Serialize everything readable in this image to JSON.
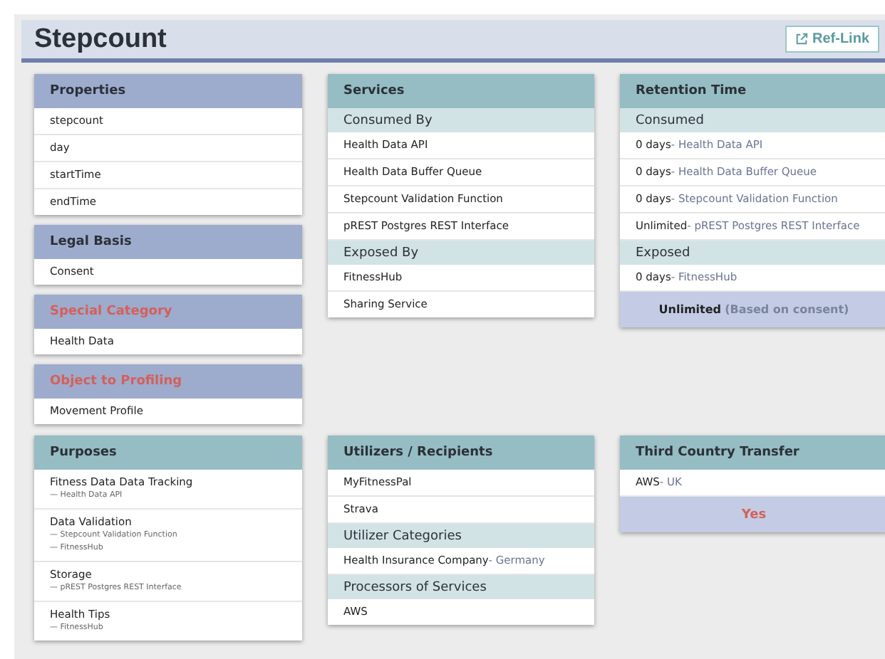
{
  "page": {
    "title": "Stepcount",
    "ref_link": "Ref-Link"
  },
  "rows": [
    [
      [
        {
          "title": "Properties",
          "color": "#9dabcd",
          "alert": false,
          "sections": [
            {
              "items": [
                {
                  "text": "stepcount"
                },
                {
                  "text": "day"
                },
                {
                  "text": "startTime"
                },
                {
                  "text": "endTime"
                }
              ]
            }
          ]
        },
        {
          "title": "Legal Basis",
          "color": "#9dabcd",
          "alert": false,
          "sections": [
            {
              "items": [
                {
                  "text": "Consent"
                }
              ]
            }
          ]
        },
        {
          "title": "Special Category",
          "color": "#9dabcd",
          "alert": true,
          "sections": [
            {
              "items": [
                {
                  "text": "Health Data"
                }
              ]
            }
          ]
        },
        {
          "title": "Object to Profiling",
          "color": "#9dabcd",
          "alert": true,
          "sections": [
            {
              "items": [
                {
                  "text": "Movement Profile"
                }
              ]
            }
          ]
        }
      ],
      [
        {
          "title": "Services",
          "color": "#95bdc3",
          "alert": false,
          "sections": [
            {
              "heading": "Consumed By",
              "items": [
                {
                  "text": "Health Data API"
                },
                {
                  "text": "Health Data Buffer Queue"
                },
                {
                  "text": "Stepcount Validation Function"
                },
                {
                  "text": "pREST Postgres REST Interface"
                }
              ]
            },
            {
              "heading": "Exposed By",
              "items": [
                {
                  "text": "FitnessHub"
                },
                {
                  "text": "Sharing Service"
                }
              ]
            }
          ]
        }
      ],
      [
        {
          "title": "Retention Time",
          "color": "#95bdc3",
          "alert": false,
          "sections": [
            {
              "heading": "Consumed",
              "items": [
                {
                  "text": "0 days",
                  "note": "- Health Data API"
                },
                {
                  "text": "0 days",
                  "note": "- Health Data Buffer Queue"
                },
                {
                  "text": "0 days",
                  "note": "- Stepcount Validation Function"
                },
                {
                  "text": "Unlimited",
                  "note": "- pREST Postgres REST Interface"
                }
              ]
            },
            {
              "heading": "Exposed",
              "items": [
                {
                  "text": "0 days",
                  "note": "- FitnessHub"
                }
              ]
            }
          ],
          "footer": {
            "kind": "summary",
            "value": "Unlimited",
            "note": "(Based on consent)"
          }
        }
      ]
    ],
    [
      [
        {
          "title": "Purposes",
          "color": "#95bdc3",
          "alert": false,
          "sections": [
            {
              "items": [
                {
                  "text": "Fitness Data Data Tracking",
                  "sub": [
                    "— Health Data API"
                  ]
                },
                {
                  "text": "Data Validation",
                  "sub": [
                    "— Stepcount Validation Function",
                    "— FitnessHub"
                  ]
                },
                {
                  "text": "Storage",
                  "sub": [
                    "— pREST Postgres REST Interface"
                  ]
                },
                {
                  "text": "Health Tips",
                  "sub": [
                    "— FitnessHub"
                  ]
                }
              ]
            }
          ]
        }
      ],
      [
        {
          "title": "Utilizers / Recipients",
          "color": "#95bdc3",
          "alert": false,
          "sections": [
            {
              "items": [
                {
                  "text": "MyFitnessPal"
                },
                {
                  "text": "Strava"
                }
              ]
            },
            {
              "heading": "Utilizer Categories",
              "items": [
                {
                  "text": "Health Insurance Company",
                  "note": "- Germany"
                }
              ]
            },
            {
              "heading": "Processors of Services",
              "items": [
                {
                  "text": "AWS"
                }
              ]
            }
          ]
        }
      ],
      [
        {
          "title": "Third Country Transfer",
          "color": "#95bdc3",
          "alert": false,
          "sections": [
            {
              "items": [
                {
                  "text": "AWS",
                  "note": "- UK"
                }
              ]
            }
          ],
          "footer": {
            "kind": "alert",
            "value": "Yes"
          }
        }
      ]
    ]
  ]
}
